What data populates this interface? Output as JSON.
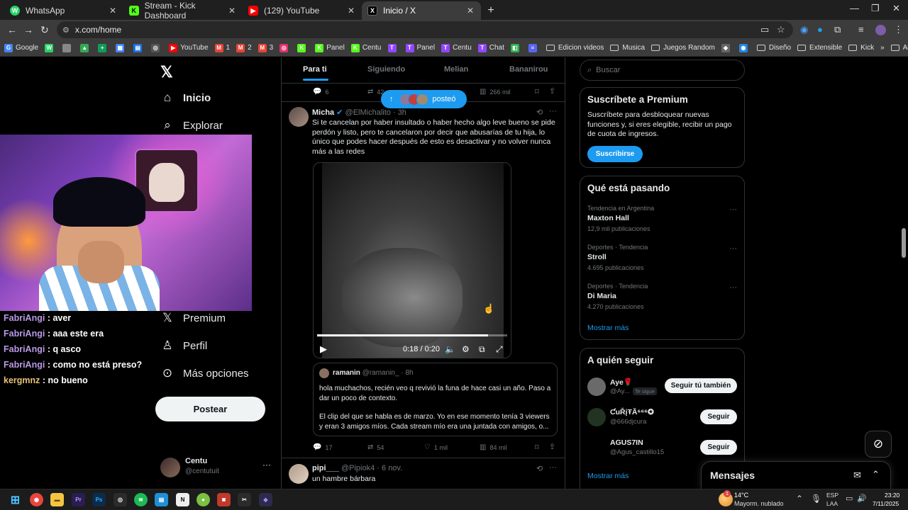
{
  "browser": {
    "tabs": [
      {
        "title": "WhatsApp",
        "color": "#25d366",
        "glyph": "W"
      },
      {
        "title": "Stream - Kick Dashboard",
        "color": "#53fc18",
        "glyph": "K"
      },
      {
        "title": "(129) YouTube",
        "color": "#ff0000",
        "glyph": "▶"
      },
      {
        "title": "Inicio / X",
        "color": "#000000",
        "glyph": "X"
      }
    ],
    "url": "x.com/home",
    "bookmarks": [
      {
        "label": "Google",
        "color": "#4285f4",
        "glyph": "G",
        "type": "site"
      },
      {
        "label": "",
        "color": "#25d366",
        "glyph": "W",
        "type": "site"
      },
      {
        "label": "",
        "color": "#888888",
        "glyph": "",
        "type": "site"
      },
      {
        "label": "",
        "color": "#34a853",
        "glyph": "▲",
        "type": "site"
      },
      {
        "label": "",
        "color": "#0f9d58",
        "glyph": "+",
        "type": "site"
      },
      {
        "label": "",
        "color": "#4285f4",
        "glyph": "▦",
        "type": "site"
      },
      {
        "label": "",
        "color": "#1a73e8",
        "glyph": "▤",
        "type": "site"
      },
      {
        "label": "",
        "color": "#555555",
        "glyph": "◎",
        "type": "site"
      },
      {
        "label": "YouTube",
        "color": "#ff0000",
        "glyph": "▶",
        "type": "site"
      },
      {
        "label": "1",
        "color": "#ea4335",
        "glyph": "M",
        "type": "site"
      },
      {
        "label": "2",
        "color": "#ea4335",
        "glyph": "M",
        "type": "site"
      },
      {
        "label": "3",
        "color": "#ea4335",
        "glyph": "M",
        "type": "site"
      },
      {
        "label": "",
        "color": "#e1306c",
        "glyph": "◎",
        "type": "site"
      },
      {
        "label": "",
        "color": "#53fc18",
        "glyph": "K",
        "type": "site"
      },
      {
        "label": "Panel",
        "color": "#53fc18",
        "glyph": "K",
        "type": "site"
      },
      {
        "label": "Centu",
        "color": "#53fc18",
        "glyph": "K",
        "type": "site"
      },
      {
        "label": "",
        "color": "#9146ff",
        "glyph": "T",
        "type": "site"
      },
      {
        "label": "Panel",
        "color": "#9146ff",
        "glyph": "T",
        "type": "site"
      },
      {
        "label": "Centu",
        "color": "#9146ff",
        "glyph": "T",
        "type": "site"
      },
      {
        "label": "Chat",
        "color": "#9146ff",
        "glyph": "T",
        "type": "site"
      },
      {
        "label": "",
        "color": "#2bb24c",
        "glyph": "◧",
        "type": "site"
      },
      {
        "label": "",
        "color": "#5865f2",
        "glyph": "≡",
        "type": "site"
      },
      {
        "label": "Edicion videos",
        "type": "folder"
      },
      {
        "label": "Musica",
        "type": "folder"
      },
      {
        "label": "Juegos Random",
        "type": "folder"
      },
      {
        "label": "",
        "color": "#666666",
        "glyph": "◆",
        "type": "site"
      },
      {
        "label": "",
        "color": "#1e88e5",
        "glyph": "◉",
        "type": "site"
      },
      {
        "label": "Diseño",
        "type": "folder"
      },
      {
        "label": "Extensible",
        "type": "folder"
      },
      {
        "label": "Kick",
        "type": "folder"
      }
    ],
    "all_bookmarks": "All Bookmarks"
  },
  "sidebar": {
    "nav": {
      "home": "Inicio",
      "explore": "Explorar",
      "premium": "Premium",
      "profile": "Perfil",
      "more": "Más opciones"
    },
    "post_button": "Postear",
    "account": {
      "name": "Centu",
      "handle": "@centutuit"
    }
  },
  "webcam_chat": [
    {
      "user": "FabriAngi",
      "msg": " : aver"
    },
    {
      "user": "FabriAngi",
      "msg": " : aaa este era"
    },
    {
      "user": "FabriAngi",
      "msg": " : q asco"
    },
    {
      "user": "FabriAngi",
      "msg": " : como no está preso?"
    },
    {
      "user": "kergmnz",
      "msg": " : no bueno"
    }
  ],
  "feed": {
    "tabs": [
      "Para ti",
      "Siguiendo",
      "Melian",
      "Bananirou"
    ],
    "new_posts_pill": "posteó",
    "prev_post_metrics": {
      "replies": "6",
      "reposts": "42",
      "views": "266 mil"
    },
    "post": {
      "name": "Micha",
      "handle": "@ElMichalito",
      "time": "3h",
      "text": "Si te cancelan por haber insultado o haber hecho algo leve bueno se pide perdón y listo, pero te cancelaron por decir que abusarías de tu hija, lo único que podes hacer después de esto es desactivar y no volver nunca más a las redes",
      "video_time": "0:18 / 0:20",
      "video_progress": 0.9,
      "quote": {
        "name": "ramanin",
        "handle": "@ramanin_",
        "time": "8h",
        "text1": "hola muchachos, recién veo q revivió la funa de hace casi un año. Paso a dar un poco de contexto.",
        "text2": "El clip del que se habla es de marzo. Yo en ese momento tenía 3 viewers y eran 3 amigos míos. Cada stream mío era una juntada con amigos, o..."
      },
      "metrics": {
        "replies": "17",
        "reposts": "54",
        "likes": "1 mil",
        "views": "84 mil"
      }
    },
    "next_post": {
      "name": "pipi___",
      "handle": "@Pipiok4",
      "time": "6 nov.",
      "text": "un hambre bárbara"
    }
  },
  "right": {
    "search_placeholder": "Buscar",
    "premium": {
      "title": "Suscríbete a Premium",
      "body": "Suscríbete para desbloquear nuevas funciones y, si eres elegible, recibir un pago de cuota de ingresos.",
      "button": "Suscribirse"
    },
    "trends": {
      "title": "Qué está pasando",
      "items": [
        {
          "category": "Tendencia en Argentina",
          "name": "Maxton Hall",
          "count": "12,9 mil publicaciones"
        },
        {
          "category": "Deportes · Tendencia",
          "name": "Stroll",
          "count": "4.695 publicaciones"
        },
        {
          "category": "Deportes · Tendencia",
          "name": "Di Maria",
          "count": "4.270 publicaciones"
        }
      ],
      "show_more": "Mostrar más"
    },
    "who_to_follow": {
      "title": "A quién seguir",
      "items": [
        {
          "name": "Aye🌹",
          "handle": "@Ay...",
          "badge": "Te sigue",
          "button": "Seguir tú también"
        },
        {
          "name": "ƇuŘįŦĂ⁶⁶⁶✪",
          "handle": "@666djcura",
          "badge": "",
          "button": "Seguir"
        },
        {
          "name": "AGUS7IN",
          "handle": "@Agus_castillo15",
          "badge": "",
          "button": "Seguir"
        }
      ],
      "show_more": "Mostrar más"
    },
    "messages": "Mensajes"
  },
  "taskbar": {
    "weather_temp": "14°C",
    "weather_desc": "Mayorm. nublado",
    "weather_badge": "1",
    "lang1": "ESP",
    "lang2": "LAA",
    "time": "23:20",
    "date": "7/11/2025"
  }
}
